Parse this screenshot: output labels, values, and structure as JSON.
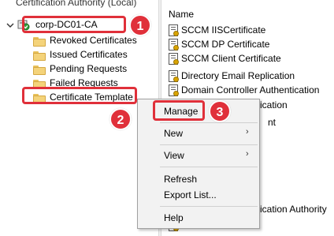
{
  "tree": {
    "root_title": "Certification Authority (Local)",
    "ca_node": "corp-DC01-CA",
    "folders": [
      "Revoked Certificates",
      "Issued Certificates",
      "Pending Requests",
      "Failed Requests",
      "Certificate Template"
    ]
  },
  "list": {
    "column_header": "Name",
    "items": [
      "SCCM IISCertificate",
      "SCCM DP Certificate",
      "SCCM Client Certificate",
      "Directory Email Replication",
      "Domain Controller Authentication",
      "ication",
      "nt",
      "",
      "",
      "",
      "ication Authority"
    ]
  },
  "context_menu": {
    "items": [
      "Manage",
      "New",
      "View",
      "Refresh",
      "Export List...",
      "Help"
    ],
    "submenu_arrow": "›"
  },
  "callouts": {
    "badges": [
      "1",
      "2",
      "3"
    ],
    "color": "#e0303a"
  },
  "icons": {
    "ca_node": "certificate-authority-icon",
    "folder": "folder-icon",
    "cert": "certificate-template-icon"
  }
}
